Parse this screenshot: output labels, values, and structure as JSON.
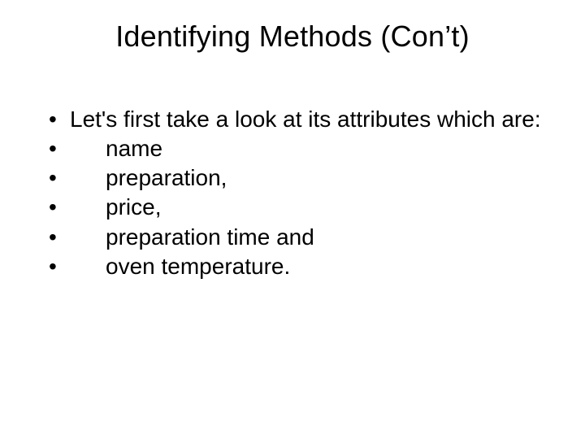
{
  "slide": {
    "title": "Identifying Methods (Con’t)",
    "bullets": [
      {
        "text": "Let's first take a look at its attributes which are:",
        "indent": false
      },
      {
        "text": "name",
        "indent": true
      },
      {
        "text": "preparation,",
        "indent": true
      },
      {
        "text": "price,",
        "indent": true
      },
      {
        "text": "preparation time and",
        "indent": true
      },
      {
        "text": "oven temperature.",
        "indent": true
      }
    ]
  }
}
